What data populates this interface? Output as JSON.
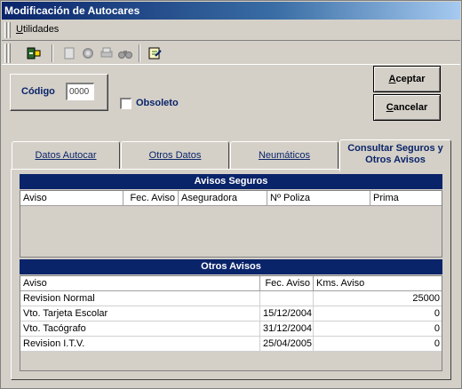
{
  "window": {
    "title": "Modificación de Autocares"
  },
  "menu": {
    "utilidades_first": "U",
    "utilidades_rest": "tilidades"
  },
  "toolbar": {
    "icons": [
      "exit-icon",
      "new-doc-icon",
      "gear-icon",
      "print-icon",
      "find-icon",
      "notes-icon"
    ]
  },
  "form": {
    "codigo_label": "Código",
    "codigo_value": "0000",
    "obsoleto_label": "Obsoleto",
    "aceptar_first": "A",
    "aceptar_rest": "ceptar",
    "cancelar_first": "C",
    "cancelar_rest": "ancelar"
  },
  "tabs": {
    "datos_autocar": "Datos Autocar",
    "otros_datos": "Otros Datos",
    "neumaticos": "Neumáticos",
    "consultar_line1": "Consultar Seguros y",
    "consultar_line2": "Otros Avisos"
  },
  "avisos_seguros": {
    "title": "Avisos Seguros",
    "columns": {
      "aviso": "Aviso",
      "fec_aviso": "Fec. Aviso",
      "aseguradora": "Aseguradora",
      "poliza": "Nº Poliza",
      "prima": "Prima"
    }
  },
  "otros_avisos": {
    "title": "Otros Avisos",
    "columns": {
      "aviso": "Aviso",
      "fec_aviso": "Fec. Aviso",
      "kms_aviso": "Kms. Aviso"
    },
    "rows": [
      {
        "aviso": "Revision Normal",
        "fec": "",
        "kms": "25000"
      },
      {
        "aviso": "Vto. Tarjeta Escolar",
        "fec": "15/12/2004",
        "kms": "0"
      },
      {
        "aviso": "Vto. Tacógrafo",
        "fec": "31/12/2004",
        "kms": "0"
      },
      {
        "aviso": "Revision I.T.V.",
        "fec": "25/04/2005",
        "kms": "0"
      }
    ]
  }
}
